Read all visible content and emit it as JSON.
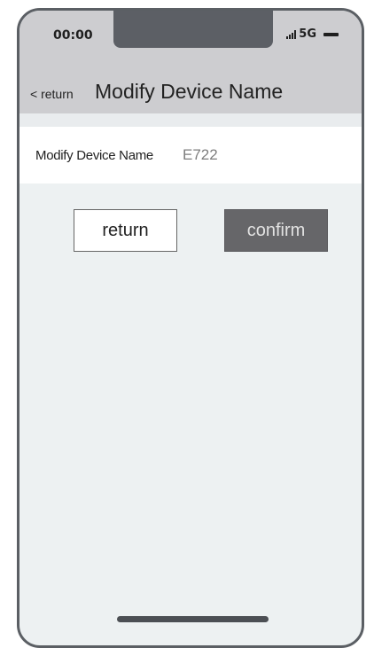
{
  "status_bar": {
    "time": "00:00",
    "network": "5G",
    "icons": [
      "signal-icon",
      "battery-icon"
    ]
  },
  "nav": {
    "back_label": "< return",
    "title": "Modify Device Name"
  },
  "form": {
    "field_label": "Modify Device Name",
    "field_value": "E722"
  },
  "actions": {
    "return_label": "return",
    "confirm_label": "confirm"
  },
  "colors": {
    "header_bg": "#cdcdd0",
    "page_bg": "#edf1f2",
    "confirm_bg": "#666669",
    "frame": "#5b5f64"
  }
}
